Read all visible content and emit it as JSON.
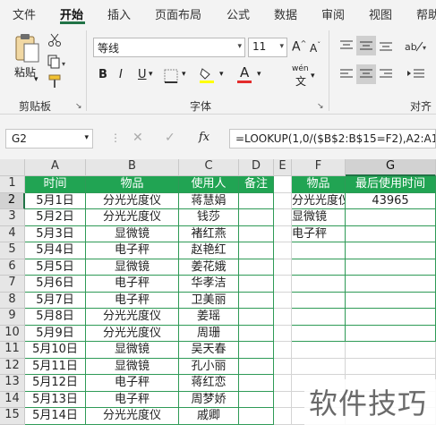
{
  "menu": [
    "文件",
    "开始",
    "插入",
    "页面布局",
    "公式",
    "数据",
    "审阅",
    "视图",
    "帮助"
  ],
  "ribbon": {
    "paste_label": "粘贴",
    "clipboard_label": "剪贴板",
    "font_name": "等线",
    "font_size": "11",
    "font_label": "字体",
    "align_label": "对齐方",
    "bold": "B",
    "italic": "I",
    "underline": "U",
    "phonetic": "wén",
    "grow_font": "A",
    "shrink_font": "A",
    "font_color_letter": "A",
    "accent_color": "#217346"
  },
  "formula_bar": {
    "name_box": "G2",
    "formula": "=LOOKUP(1,0/($B$2:B$15=F2),A2:A15)",
    "fx": "fx"
  },
  "columns": [
    "A",
    "B",
    "C",
    "D",
    "E",
    "F",
    "G"
  ],
  "row_numbers": [
    "1",
    "2",
    "3",
    "4",
    "5",
    "6",
    "7",
    "8",
    "9",
    "10",
    "11",
    "12",
    "13",
    "14",
    "15"
  ],
  "table": {
    "headers": [
      "时间",
      "物品",
      "使用人",
      "备注"
    ],
    "rows": [
      [
        "5月1日",
        "分光光度仪",
        "蒋慧娟",
        ""
      ],
      [
        "5月2日",
        "分光光度仪",
        "钱莎",
        ""
      ],
      [
        "5月3日",
        "显微镜",
        "褚红燕",
        ""
      ],
      [
        "5月4日",
        "电子秤",
        "赵艳红",
        ""
      ],
      [
        "5月5日",
        "显微镜",
        "姜花娥",
        ""
      ],
      [
        "5月6日",
        "电子秤",
        "华孝洁",
        ""
      ],
      [
        "5月7日",
        "电子秤",
        "卫美丽",
        ""
      ],
      [
        "5月8日",
        "分光光度仪",
        "姜瑶",
        ""
      ],
      [
        "5月9日",
        "分光光度仪",
        "周珊",
        ""
      ],
      [
        "5月10日",
        "显微镜",
        "吴天春",
        ""
      ],
      [
        "5月11日",
        "显微镜",
        "孔小丽",
        ""
      ],
      [
        "5月12日",
        "电子秤",
        "蒋红恋",
        ""
      ],
      [
        "5月13日",
        "电子秤",
        "周梦娇",
        ""
      ],
      [
        "5月14日",
        "分光光度仪",
        "戚卿",
        ""
      ]
    ]
  },
  "lookup": {
    "headers": [
      "物品",
      "最后使用时间"
    ],
    "rows": [
      [
        "分光光度仪",
        "43965"
      ],
      [
        "显微镜",
        ""
      ],
      [
        "电子秤",
        ""
      ]
    ]
  },
  "watermark": "软件技巧"
}
